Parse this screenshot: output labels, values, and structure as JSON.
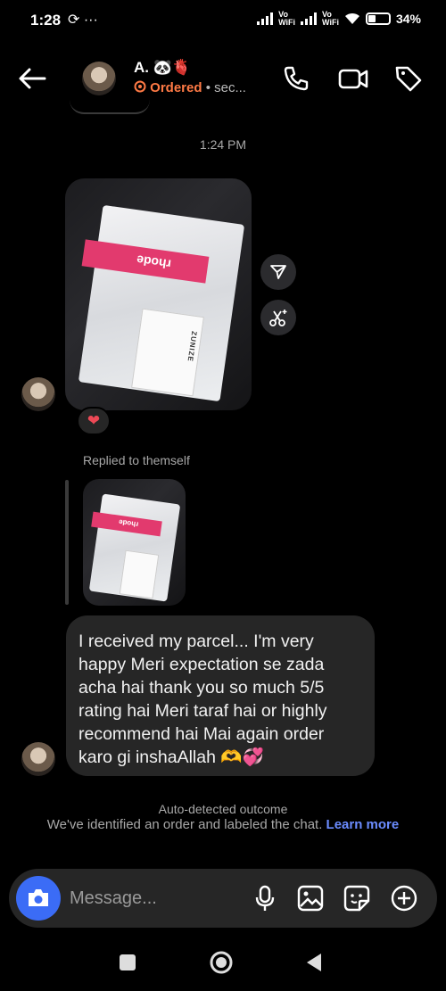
{
  "status_bar": {
    "time": "1:28",
    "left_icons": "⟳ ···",
    "vowifi_1": "Vo\nWiFi",
    "vowifi_2": "Vo\nWiFi",
    "battery": "34%"
  },
  "header": {
    "name": "A. 🐼🫀",
    "ordered_label": "Ordered",
    "subtitle": " • sec..."
  },
  "chat": {
    "timestamp": "1:24 PM",
    "reaction": "❤",
    "replied_label": "Replied to themself",
    "message": "I received my parcel... I'm very happy Meri expectation se zada acha hai thank you so much 5/5 rating hai Meri taraf hai or highly recommend hai Mai again order karo gi inshaAllah 🫶💞",
    "photo_text": {
      "brand": "rhode",
      "pink_box": "rhode",
      "card_brand": "ZUNIZE"
    }
  },
  "auto_detected": {
    "title": "Auto-detected outcome",
    "text": "We've identified an order and labeled the chat. ",
    "learn_more": "Learn more"
  },
  "composer": {
    "placeholder": "Message..."
  },
  "colors": {
    "accent": "#3b6cf6",
    "ordered": "#ff7a45",
    "link": "#6b8cff",
    "bubble": "#262626"
  }
}
